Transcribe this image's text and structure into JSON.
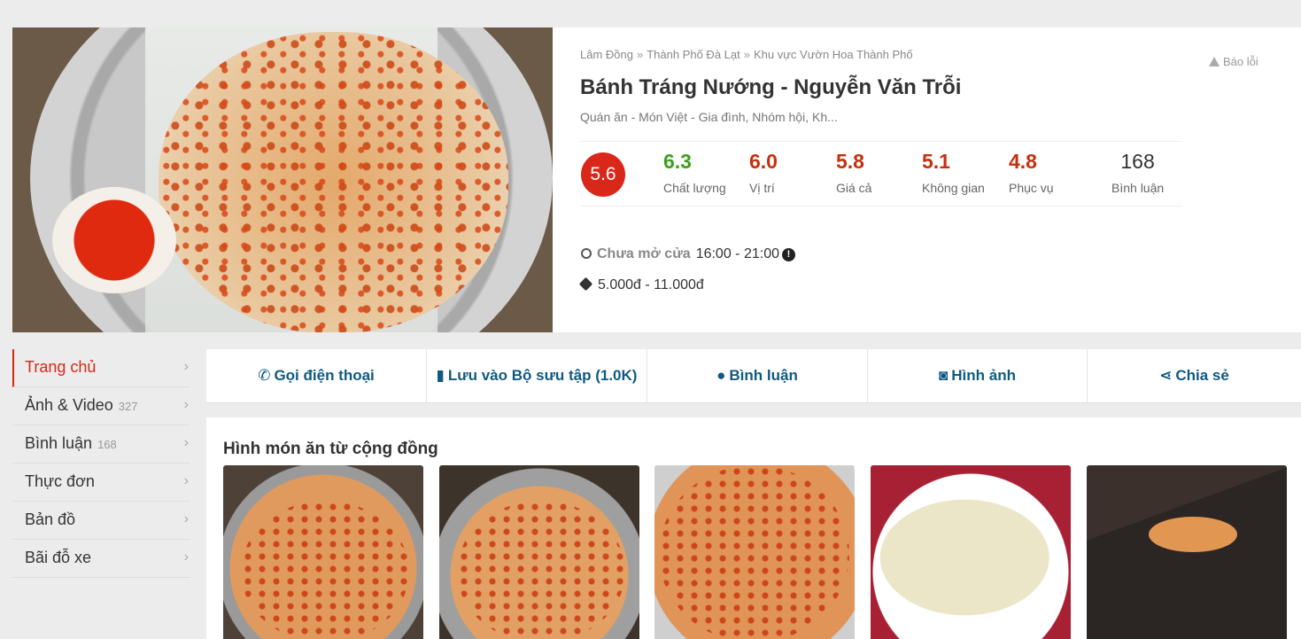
{
  "breadcrumb": [
    "Lâm Đồng",
    "Thành Phố Đà Lạt",
    "Khu vực Vườn Hoa Thành Phố"
  ],
  "breadcrumb_sep": "»",
  "report_label": "Báo lỗi",
  "title": "Bánh Tráng Nướng - Nguyễn Văn Trỗi",
  "categories": "Quán ăn - Món Việt - Gia đình, Nhóm hội, Kh...",
  "overall_score": "5.6",
  "metrics": [
    {
      "value": "6.3",
      "label": "Chất lượng",
      "color": "#3e9e1f"
    },
    {
      "value": "6.0",
      "label": "Vị trí",
      "color": "#c5300f"
    },
    {
      "value": "5.8",
      "label": "Giá cả",
      "color": "#c5300f"
    },
    {
      "value": "5.1",
      "label": "Không gian",
      "color": "#c5300f"
    },
    {
      "value": "4.8",
      "label": "Phục vụ",
      "color": "#c5300f"
    },
    {
      "value": "168",
      "label": "Bình luận",
      "color": "#333333"
    }
  ],
  "hours": {
    "status": "Chưa mở cửa",
    "range": "16:00 - 21:00",
    "info_glyph": "!"
  },
  "price_range": "5.000đ - 11.000đ",
  "sidebar": [
    {
      "label": "Trang chủ",
      "count": "",
      "active": true
    },
    {
      "label": "Ảnh & Video",
      "count": "327"
    },
    {
      "label": "Bình luận",
      "count": "168"
    },
    {
      "label": "Thực đơn",
      "count": ""
    },
    {
      "label": "Bản đồ",
      "count": ""
    },
    {
      "label": "Bãi đỗ xe",
      "count": ""
    }
  ],
  "chevron": "›",
  "actions": [
    {
      "icon": "phone-icon",
      "glyph": "✆",
      "label": "Gọi điện thoại"
    },
    {
      "icon": "bookmark-icon",
      "glyph": "▮",
      "label": "Lưu vào Bộ sưu tập (1.0K)"
    },
    {
      "icon": "comment-icon",
      "glyph": "●",
      "label": "Bình luận"
    },
    {
      "icon": "camera-icon",
      "glyph": "◙",
      "label": "Hình ảnh"
    },
    {
      "icon": "share-icon",
      "glyph": "⋖",
      "label": "Chia sẻ"
    }
  ],
  "community_title": "Hình món ăn từ cộng đồng",
  "accent_color": "#d9281a",
  "link_color": "#0f5a82"
}
